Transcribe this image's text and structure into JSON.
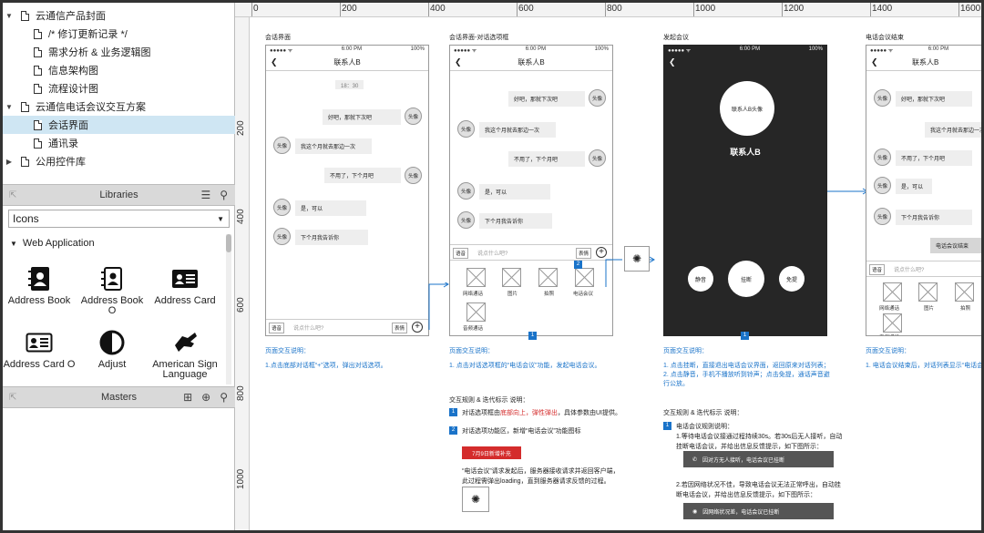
{
  "tree": [
    {
      "label": "云通信产品封面",
      "type": "folder",
      "arrow": "▼"
    },
    {
      "label": "/* 修订更新记录 */",
      "type": "page"
    },
    {
      "label": "需求分析 & 业务逻辑图",
      "type": "page"
    },
    {
      "label": "信息架构图",
      "type": "page"
    },
    {
      "label": "流程设计图",
      "type": "page"
    },
    {
      "label": "云通信电话会议交互方案",
      "type": "folder",
      "arrow": "▼"
    },
    {
      "label": "会话界面",
      "type": "page",
      "selected": true
    },
    {
      "label": "通讯录",
      "type": "page"
    },
    {
      "label": "公用控件库",
      "type": "folder",
      "arrow": "▶"
    }
  ],
  "libraries": {
    "title": "Libraries",
    "selected": "Icons",
    "group": "Web Application",
    "items": [
      {
        "label": "Address Book",
        "icon": "address-book-icon"
      },
      {
        "label": "Address Book O",
        "icon": "address-book-outline-icon"
      },
      {
        "label": "Address Card",
        "icon": "address-card-icon"
      },
      {
        "label": "Address Card O",
        "icon": "address-card-outline-icon"
      },
      {
        "label": "Adjust",
        "icon": "adjust-icon"
      },
      {
        "label": "American Sign Language",
        "icon": "sign-language-icon"
      }
    ]
  },
  "masters": {
    "title": "Masters"
  },
  "ruler": {
    "top": [
      "0",
      "200",
      "400",
      "600",
      "800",
      "1000",
      "1200",
      "1400",
      "1600"
    ],
    "left": [
      "200",
      "400",
      "600",
      "800",
      "1000"
    ]
  },
  "colors": {
    "accent": "#1a73c9",
    "selected": "#cfe6f3",
    "dark": "#262626",
    "red": "#d42c2c"
  },
  "canvas": {
    "titles": [
      "会话界面",
      "会话界面-对话选项框",
      "发起会议",
      "电话会议结束"
    ],
    "status": {
      "carrier": "●●●●● ᯤ",
      "time": "6:00 PM",
      "battery": "100%"
    },
    "contact": "联系人B",
    "time_stamp": "18：30",
    "avatar": "头像",
    "p1_msgs": [
      "好吧，那就下次吧",
      "我这个月就去那边一次",
      "不用了，下个月吧",
      "是，可以",
      "下个月我告诉你"
    ],
    "p2_msgs": [
      "好吧，那就下次吧",
      "我这个月就去那边一次",
      "不用了，下个月吧",
      "是，可以",
      "下个月我告诉你"
    ],
    "p4_msgs": [
      "好吧，那就下次吧",
      "我这个月就去那边一次",
      "不用了，下个月吧",
      "是，可以",
      "下个月我告诉你"
    ],
    "input": {
      "voice": "语音",
      "placeholder": "说点什么吧?",
      "emoji": "表情",
      "plus": "+"
    },
    "options": [
      "网络通话",
      "图片",
      "拍照",
      "电话会议",
      "音频通话"
    ],
    "badge1": "1",
    "badge2": "2",
    "call": {
      "avatar": "联系人B头像",
      "name": "联系人B",
      "mute": "静音",
      "hangup": "挂断",
      "speaker": "免提"
    },
    "ended": "电话会议结束",
    "notes": {
      "n1_title": "页面交互说明：",
      "n1_text": "1.点击底部对话框“+”选项，弹出对话选项。",
      "n2_title": "页面交互说明：",
      "n2_text": "1. 点击对话选项框的“电话会议”功能，发起电话会议。",
      "n3_title": "页面交互说明：",
      "n3_l1": "1. 点击挂断，直接退出电话会议界面，返回原来对话列表；",
      "n3_l2": "2. 点击静音，手机不播放听到铃声；点击免提，通话声音避",
      "n3_l3": "行公放。",
      "n4_title": "页面交互说明：",
      "n4_text": "1. 电话会议结束后，对话列表显示“电话会议结",
      "rules_title": "交互规则 & 迭代标示 说明：",
      "r1_a": "对话选项框由",
      "r1_b": "底部向上，弹性弹出",
      "r1_c": "，具体参数由UI提供。",
      "r2": "对话选项功能区，新增“电话会议”功能图标",
      "red_tag": "7月9日新增补充",
      "r3_l1": "“电话会议”请求发起后，服务器接收请求并返回客户端，",
      "r3_l2": "此过程需弹出loading，直到服务器请求反馈的过程。",
      "rules2_title": "交互规则 & 迭代标示 说明：",
      "m1": "电话会议规则说明：",
      "m2": "1.等待电话会议接通过程持续30s。若30s后无人接听，自动",
      "m3": "挂断电话会议，并给出信息反馈提示，如下图所示：",
      "g1": "因对方无人接听，电话会议已挂断",
      "m4": "2.若因网络状况不佳，导致电话会议无法正常呼出，自动挂",
      "m5": "断电话会议，并给出信息反馈提示，如下图所示：",
      "g2": "因网络状况差，电话会议已挂断"
    }
  }
}
